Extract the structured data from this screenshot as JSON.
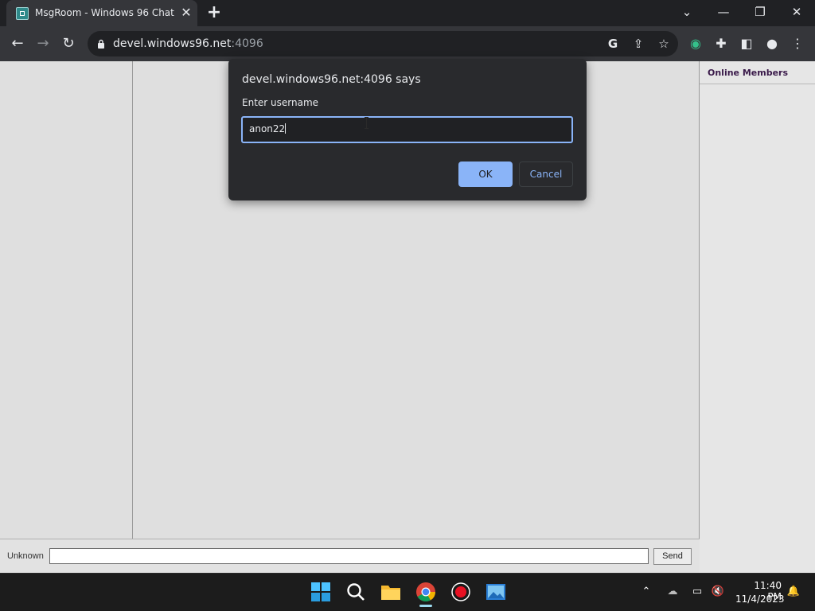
{
  "browser": {
    "tab_title": "MsgRoom - Windows 96 Chat",
    "url_host": "devel.windows96.net",
    "url_port": ":4096"
  },
  "page": {
    "members_title": "Online Members",
    "username_label": "Unknown",
    "message_input_value": "",
    "send_label": "Send"
  },
  "dialog": {
    "title": "devel.windows96.net:4096 says",
    "message": "Enter username",
    "input_value": "anon22",
    "ok_label": "OK",
    "cancel_label": "Cancel"
  },
  "taskbar": {
    "time": "11:40 PM",
    "date": "11/4/2023",
    "apps": [
      "start-icon",
      "search-icon",
      "file-explorer-icon",
      "chrome-icon",
      "record-icon",
      "photos-icon"
    ]
  },
  "colors": {
    "accent": "#8ab4f8",
    "page_bg": "#dfdfdf",
    "dialog_bg": "#292a2d",
    "chrome_dark": "#202124"
  }
}
